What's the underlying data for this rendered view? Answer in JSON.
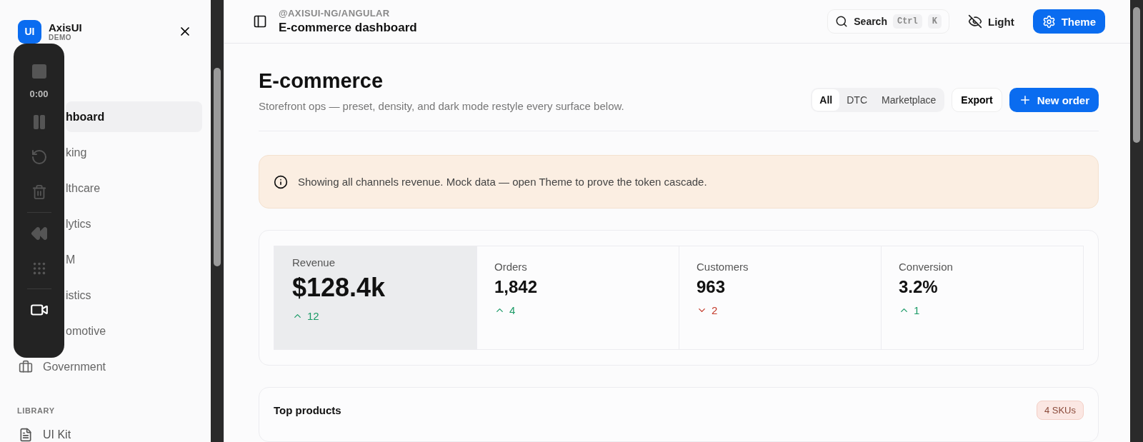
{
  "brand": {
    "logo": "UI",
    "name": "AxisUI",
    "tag": "DEMO"
  },
  "recorder": {
    "timer": "0:00"
  },
  "sidebar": {
    "items": [
      {
        "label": "hboard",
        "selected": true,
        "kind": "partial"
      },
      {
        "label": "king",
        "selected": false,
        "kind": "partial"
      },
      {
        "label": "lthcare",
        "selected": false,
        "kind": "partial"
      },
      {
        "label": "lytics",
        "selected": false,
        "kind": "partial"
      },
      {
        "label": "M",
        "selected": false,
        "kind": "partial"
      },
      {
        "label": "istics",
        "selected": false,
        "kind": "partial"
      },
      {
        "label": "omotive",
        "selected": false,
        "kind": "partial"
      },
      {
        "label": "Government",
        "selected": false,
        "kind": "full"
      }
    ],
    "section": {
      "title": "LIBRARY",
      "items": [
        {
          "label": "UI Kit"
        }
      ]
    }
  },
  "header": {
    "package": "@AXISUI-NG/ANGULAR",
    "title": "E-commerce dashboard",
    "search": {
      "label": "Search",
      "keys": [
        "Ctrl",
        "K"
      ]
    },
    "mode": "Light",
    "theme": "Theme"
  },
  "page": {
    "title": "E-commerce",
    "subtitle": "Storefront ops — preset, density, and dark mode restyle every surface below.",
    "filters": [
      {
        "label": "All",
        "selected": true
      },
      {
        "label": "DTC",
        "selected": false
      },
      {
        "label": "Marketplace",
        "selected": false
      }
    ],
    "export": "Export",
    "new_order": "New order"
  },
  "banner": {
    "text": "Showing all channels revenue. Mock data — open Theme to prove the token cascade."
  },
  "stats": [
    {
      "label": "Revenue",
      "value": "$128.4k",
      "delta": "12",
      "rising": true,
      "selected": true
    },
    {
      "label": "Orders",
      "value": "1,842",
      "delta": "4",
      "rising": true,
      "selected": false
    },
    {
      "label": "Customers",
      "value": "963",
      "delta": "2",
      "rising": false,
      "selected": false
    },
    {
      "label": "Conversion",
      "value": "3.2%",
      "delta": "1",
      "rising": true,
      "selected": false
    }
  ],
  "top_products": {
    "title": "Top products",
    "badge": "4 SKUs"
  }
}
